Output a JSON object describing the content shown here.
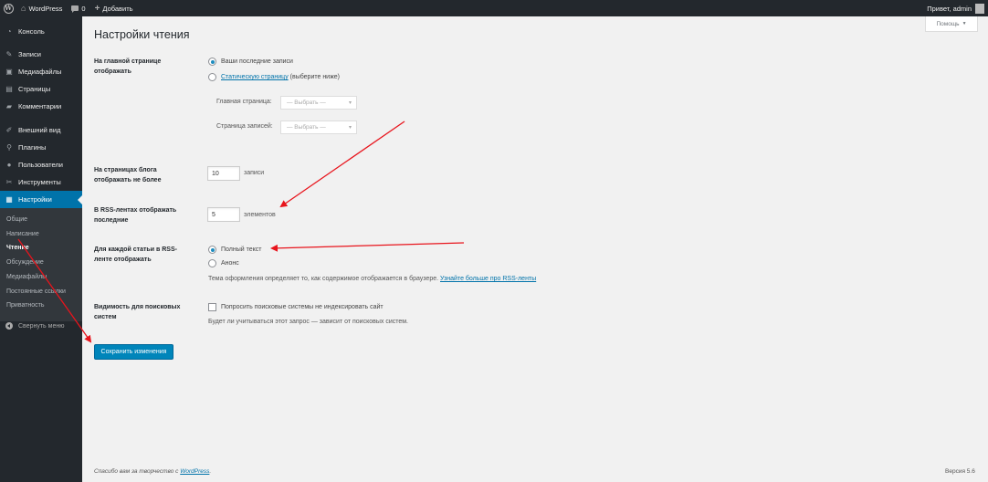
{
  "admin_bar": {
    "site_name": "WordPress",
    "comments_count": "0",
    "add_new": "Добавить",
    "greeting": "Привет, admin"
  },
  "sidebar": {
    "items": [
      {
        "label": "Консоль",
        "icon": "dashboard-icon"
      },
      {
        "label": "Записи",
        "icon": "pin-icon"
      },
      {
        "label": "Медиафайлы",
        "icon": "media-icon"
      },
      {
        "label": "Страницы",
        "icon": "page-icon"
      },
      {
        "label": "Комментарии",
        "icon": "comment-icon"
      },
      {
        "label": "Внешний вид",
        "icon": "brush-icon"
      },
      {
        "label": "Плагины",
        "icon": "plugin-icon"
      },
      {
        "label": "Пользователи",
        "icon": "users-icon"
      },
      {
        "label": "Инструменты",
        "icon": "wrench-icon"
      },
      {
        "label": "Настройки",
        "icon": "settings-icon"
      }
    ],
    "submenu": [
      "Общие",
      "Написание",
      "Чтение",
      "Обсуждение",
      "Медиафайлы",
      "Постоянные ссылки",
      "Приватность"
    ],
    "collapse": "Свернуть меню"
  },
  "help_tab": "Помощь",
  "page_title": "Настройки чтения",
  "front_page": {
    "label": "На главной странице отображать",
    "option_latest": "Ваши последние записи",
    "option_static_link": "Статическую страницу",
    "option_static_rest": " (выберите ниже)",
    "homepage_label": "Главная страница:",
    "posts_page_label": "Страница записей:",
    "select_placeholder": "— Выбрать —"
  },
  "posts_per_page": {
    "label": "На страницах блога отображать не более",
    "value": "10",
    "suffix": "записи"
  },
  "rss_count": {
    "label": "В RSS-лентах отображать последние",
    "value": "5",
    "suffix": "элементов"
  },
  "rss_content": {
    "label": "Для каждой статьи в RSS-ленте отображать",
    "option_full": "Полный текст",
    "option_summary": "Анонс",
    "description": "Тема оформления определяет то, как содержимое отображается в браузере.",
    "description_link": "Узнайте больше про RSS-ленты"
  },
  "visibility": {
    "label": "Видимость для поисковых систем",
    "checkbox_label": "Попросить поисковые системы не индексировать сайт",
    "description": "Будет ли учитываться этот запрос — зависит от поисковых систем."
  },
  "save_button": "Сохранить изменения",
  "footer": {
    "thanks_prefix": "Спасибо вам за творчество с ",
    "thanks_link": "WordPress",
    "thanks_suffix": ".",
    "version": "Версия 5.6"
  },
  "colors": {
    "admin_dark": "#23282d",
    "submenu_bg": "#32373c",
    "accent_blue": "#0073aa",
    "annotation_red": "#e8141c"
  }
}
